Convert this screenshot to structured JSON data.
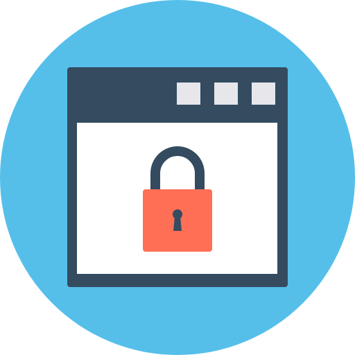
{
  "icon": {
    "subject": "padlock-in-browser-window",
    "colors": {
      "background_circle": "#55BFEA",
      "window_frame": "#344B60",
      "window_buttons": "#E6E6EB",
      "content_area": "#FFFFFF",
      "lock_body": "#FF6F55",
      "lock_shackle": "#344B60",
      "keyhole": "#344B60"
    },
    "window_button_icons": [
      "window-button-icon",
      "window-button-icon",
      "window-button-icon"
    ]
  }
}
